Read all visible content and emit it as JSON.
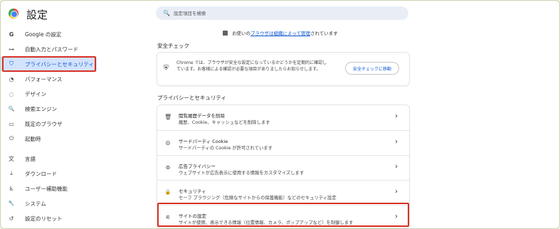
{
  "header": {
    "title": "設定",
    "search_placeholder": "設定項目を検索"
  },
  "sidebar": {
    "items": [
      {
        "label": "Google の設定",
        "icon": "G"
      },
      {
        "label": "自動入力とパスワード",
        "icon": "⊶"
      },
      {
        "label": "プライバシーとセキュリティ",
        "icon": "⛉"
      },
      {
        "label": "パフォーマンス",
        "icon": "◔"
      },
      {
        "label": "デザイン",
        "icon": "◌"
      },
      {
        "label": "検索エンジン",
        "icon": "🔍"
      },
      {
        "label": "既定のブラウザ",
        "icon": "▭"
      },
      {
        "label": "起動時",
        "icon": "⏻"
      },
      {
        "label": "言語",
        "icon": "文"
      },
      {
        "label": "ダウンロード",
        "icon": "⤓"
      },
      {
        "label": "ユーザー補助機能",
        "icon": "♿"
      },
      {
        "label": "システム",
        "icon": "🔧"
      },
      {
        "label": "設定のリセット",
        "icon": "↺"
      }
    ]
  },
  "managed": {
    "prefix": "お使いの",
    "link": "ブラウザは組織によって管理",
    "suffix": "されています"
  },
  "safety_check": {
    "section_title": "安全チェック",
    "text": "Chrome では、ブラウザが安全な設定になっているかどうかを定期的に確認しています。お客様による確認が必要な項目がありましたらお知らせします。",
    "button": "安全チェックに移動"
  },
  "privacy": {
    "section_title": "プライバシーとセキュリティ",
    "rows": [
      {
        "title": "閲覧履歴データを削除",
        "subtitle": "履歴、Cookie、キャッシュなどを削除します",
        "icon": "🗑"
      },
      {
        "title": "サードパーティ Cookie",
        "subtitle": "サードパーティの Cookie が許可されています",
        "icon": "◎"
      },
      {
        "title": "広告プライバシー",
        "subtitle": "ウェブサイトが広告表示に使用する情報をカスタマイズします",
        "icon": "⊚"
      },
      {
        "title": "セキュリティ",
        "subtitle": "セーフ ブラウジング（危険なサイトからの保護機能）などのセキュリティ設定",
        "icon": "🔒"
      },
      {
        "title": "サイトの設定",
        "subtitle": "サイトが使用、表示できる情報（位置情報、カメラ、ポップアップなど）を制御します",
        "icon": "⚟"
      }
    ]
  },
  "colors": {
    "accent": "#0b57d0",
    "active_bg": "#d3e3fd",
    "highlight": "#d93025"
  }
}
